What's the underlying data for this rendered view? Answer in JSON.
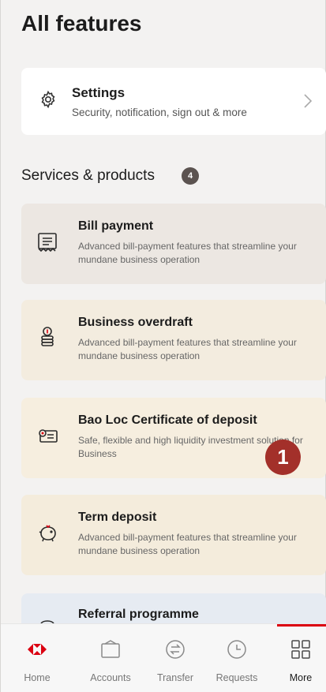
{
  "page_title": "All features",
  "settings": {
    "title": "Settings",
    "subtitle": "Security, notification, sign out & more"
  },
  "services": {
    "heading": "Services & products",
    "count": "4"
  },
  "cards": [
    {
      "title": "Bill payment",
      "desc": "Advanced bill-payment features that streamline your mundane business operation",
      "icon": "bill-icon"
    },
    {
      "title": "Business overdraft",
      "desc": "Advanced bill-payment features that streamline your mundane business operation",
      "icon": "coin-stack-icon"
    },
    {
      "title": "Bao Loc Certificate of deposit",
      "desc": "Safe, flexible and high liquidity investment solution for Business",
      "icon": "certificate-icon"
    },
    {
      "title": "Term deposit",
      "desc": "Advanced bill-payment features that streamline your mundane business operation",
      "icon": "piggy-bank-icon"
    },
    {
      "title": "Referral programme",
      "desc": "",
      "icon": "referral-icon"
    }
  ],
  "step_marker": "1",
  "tabbar": {
    "tabs": [
      {
        "label": "Home",
        "icon": "hexagon-logo-icon"
      },
      {
        "label": "Accounts",
        "icon": "wallet-icon"
      },
      {
        "label": "Transfer",
        "icon": "transfer-icon"
      },
      {
        "label": "Requests",
        "icon": "clock-icon"
      },
      {
        "label": "More",
        "icon": "grid-icon"
      }
    ]
  },
  "colors": {
    "brand_red": "#db0011",
    "marker_red": "#a3302a",
    "badge_grey": "#5b5350"
  }
}
